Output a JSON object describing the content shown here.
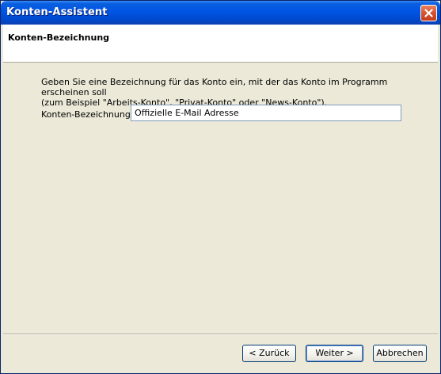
{
  "window": {
    "title": "Konten-Assistent"
  },
  "header": {
    "title": "Konten-Bezeichnung"
  },
  "main": {
    "description_line1": "Geben Sie eine Bezeichnung für das Konto ein, mit der das Konto im Programm erscheinen soll",
    "description_line2": "(zum Beispiel \"Arbeits-Konto\", \"Privat-Konto\" oder \"News-Konto\").",
    "field_label": "Konten-Bezeichnung:",
    "field_value": "Offizielle E-Mail Adresse"
  },
  "buttons": {
    "back": "< Zurück",
    "next": "Weiter >",
    "cancel": "Abbrechen"
  },
  "icons": {
    "close": "close-icon"
  },
  "colors": {
    "titlebar": "#0054e3",
    "panel": "#ece9d8",
    "close": "#d9532f"
  }
}
